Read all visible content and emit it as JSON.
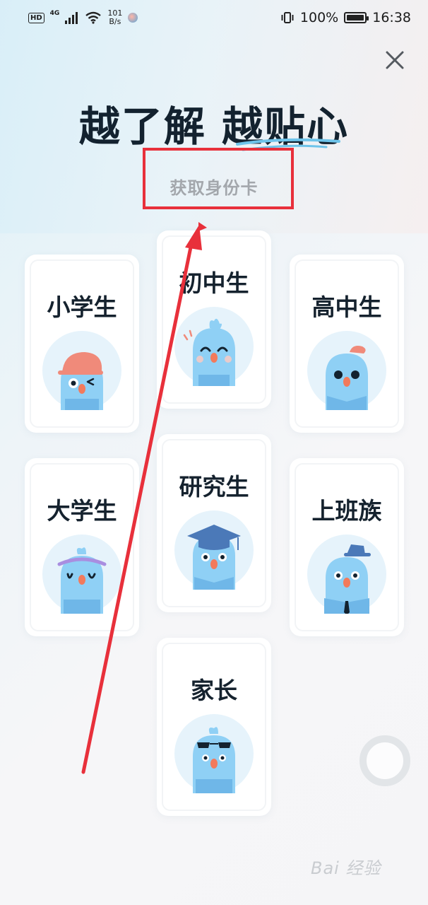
{
  "status_bar": {
    "hd": "HD",
    "network": "4G",
    "speed_value": "101",
    "speed_unit": "B/s",
    "battery": "100%",
    "time": "16:38"
  },
  "header": {
    "title": "越了解 越贴心",
    "subtitle": "获取身份卡"
  },
  "cards": [
    {
      "label": "小学生",
      "accessory": "cap"
    },
    {
      "label": "初中生",
      "accessory": "tuft"
    },
    {
      "label": "高中生",
      "accessory": "beret"
    },
    {
      "label": "大学生",
      "accessory": "headband"
    },
    {
      "label": "研究生",
      "accessory": "graduation-cap"
    },
    {
      "label": "上班族",
      "accessory": "fedora"
    },
    {
      "label": "家长",
      "accessory": "sunglasses"
    }
  ],
  "watermark": "Bai 经验",
  "colors": {
    "accent_red": "#e8303b",
    "title_dark": "#13222f",
    "mascot_blue": "#8fd0f5",
    "avatar_bg": "#e6f3fb"
  }
}
